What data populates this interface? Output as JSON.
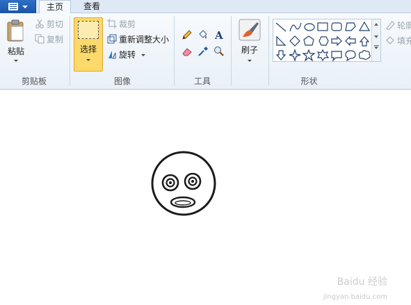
{
  "tabs": {
    "home": "主页",
    "view": "查看"
  },
  "clipboard": {
    "paste": "粘贴",
    "cut": "剪切",
    "copy": "复制",
    "group_name": "剪贴板"
  },
  "image": {
    "select": "选择",
    "crop": "裁剪",
    "resize": "重新调整大小",
    "rotate": "旋转",
    "group_name": "图像"
  },
  "tools": {
    "group_name": "工具",
    "items": [
      "pencil-icon",
      "fill-icon",
      "text-icon",
      "eraser-icon",
      "color-picker-icon",
      "magnifier-icon"
    ]
  },
  "brushes": {
    "label": "刷子"
  },
  "shapes": {
    "group_name": "形状",
    "outline": "轮廓",
    "fill": "填充"
  },
  "watermark": {
    "brand": "Baidu 经验",
    "url": "jingyan.baidu.com"
  },
  "colors": {
    "selected_highlight": "#fbd96a",
    "file_button": "#1b55a8"
  }
}
